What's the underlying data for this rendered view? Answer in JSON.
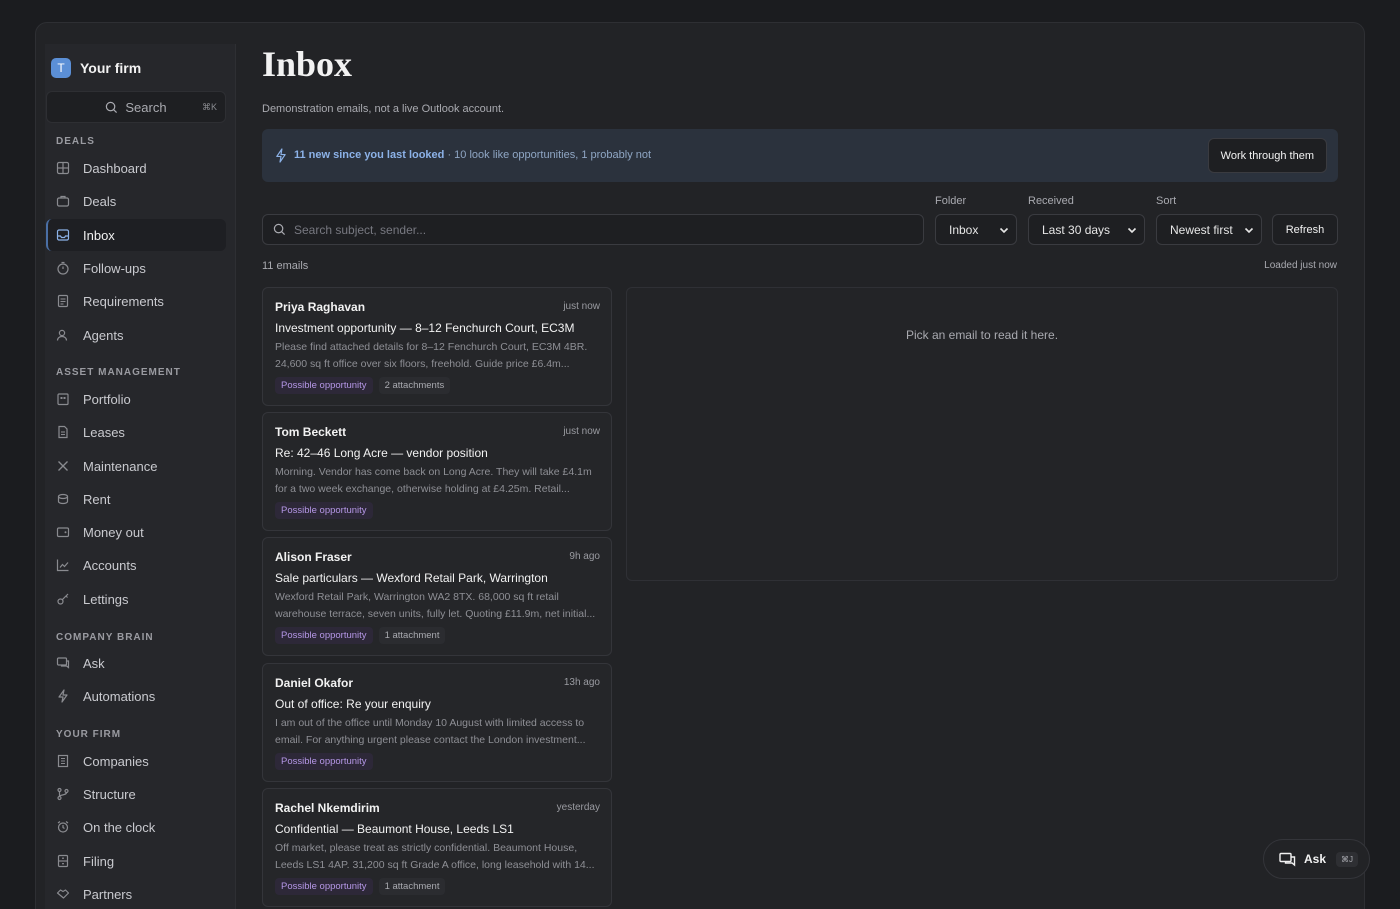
{
  "sidebar": {
    "brand_initial": "T",
    "brand_name": "Your firm",
    "search_label": "Search",
    "search_shortcut": "⌘K",
    "sections": [
      {
        "title": "DEALS"
      },
      {
        "title": "ASSET MANAGEMENT"
      },
      {
        "title": "COMPANY BRAIN"
      },
      {
        "title": "YOUR FIRM"
      }
    ],
    "items": [
      {
        "label": "Dashboard",
        "icon": "grid-icon"
      },
      {
        "label": "Deals",
        "icon": "briefcase-icon"
      },
      {
        "label": "Inbox",
        "icon": "inbox-icon"
      },
      {
        "label": "Follow-ups",
        "icon": "timer-icon"
      },
      {
        "label": "Requirements",
        "icon": "clipboard-icon"
      },
      {
        "label": "Agents",
        "icon": "users-icon"
      },
      {
        "label": "Portfolio",
        "icon": "building-icon"
      },
      {
        "label": "Leases",
        "icon": "document-icon"
      },
      {
        "label": "Maintenance",
        "icon": "wrench-icon"
      },
      {
        "label": "Rent",
        "icon": "coins-icon"
      },
      {
        "label": "Money out",
        "icon": "wallet-icon"
      },
      {
        "label": "Accounts",
        "icon": "chart-line-icon"
      },
      {
        "label": "Lettings",
        "icon": "key-icon"
      },
      {
        "label": "Ask",
        "icon": "chat-icon"
      },
      {
        "label": "Automations",
        "icon": "bolt-icon"
      },
      {
        "label": "Companies",
        "icon": "office-icon"
      },
      {
        "label": "Structure",
        "icon": "branch-icon"
      },
      {
        "label": "On the clock",
        "icon": "alarm-icon"
      },
      {
        "label": "Filing",
        "icon": "filing-icon"
      },
      {
        "label": "Partners",
        "icon": "handshake-icon"
      }
    ]
  },
  "main": {
    "title": "Inbox",
    "subtitle": "Demonstration emails, not a live Outlook account.",
    "banner": {
      "strong": "11 new since you last looked",
      "rest": " · 10 look like opportunities, 1 probably not",
      "button": "Work through them"
    },
    "filters": {
      "search_placeholder": "Search subject, sender...",
      "folder_label": "Folder",
      "folder_value": "Inbox",
      "received_label": "Received",
      "received_value": "Last 30 days",
      "sort_label": "Sort",
      "sort_value": "Newest first",
      "refresh": "Refresh"
    },
    "count": "11 emails",
    "loaded": "Loaded just now",
    "emails": [
      {
        "sender": "Priya Raghavan",
        "time": "just now",
        "subject": "Investment opportunity — 8–12 Fenchurch Court, EC3M",
        "preview": "Please find attached details for 8–12 Fenchurch Court, EC3M 4BR. 24,600 sq ft office over six floors, freehold. Guide price £6.4m...",
        "tag": "Possible opportunity",
        "attachments": "2 attachments"
      },
      {
        "sender": "Tom Beckett",
        "time": "just now",
        "subject": "Re: 42–46 Long Acre — vendor position",
        "preview": "Morning. Vendor has come back on Long Acre. They will take £4.1m for a two week exchange, otherwise holding at £4.25m. Retail...",
        "tag": "Possible opportunity",
        "attachments": ""
      },
      {
        "sender": "Alison Fraser",
        "time": "9h ago",
        "subject": "Sale particulars — Wexford Retail Park, Warrington",
        "preview": "Wexford Retail Park, Warrington WA2 8TX. 68,000 sq ft retail warehouse terrace, seven units, fully let. Quoting £11.9m, net initial...",
        "tag": "Possible opportunity",
        "attachments": "1 attachment"
      },
      {
        "sender": "Daniel Okafor",
        "time": "13h ago",
        "subject": "Out of office: Re your enquiry",
        "preview": "I am out of the office until Monday 10 August with limited access to email. For anything urgent please contact the London investment...",
        "tag": "Possible opportunity",
        "attachments": ""
      },
      {
        "sender": "Rachel Nkemdirim",
        "time": "yesterday",
        "subject": "Confidential — Beaumont House, Leeds LS1",
        "preview": "Off market, please treat as strictly confidential. Beaumont House, Leeds LS1 4AP. 31,200 sq ft Grade A office, long leasehold with 14...",
        "tag": "Possible opportunity",
        "attachments": "1 attachment"
      }
    ],
    "reader_placeholder": "Pick an email to read it here."
  },
  "ask": {
    "label": "Ask",
    "shortcut": "⌘J"
  },
  "colors": {
    "accent": "#5b8fd6",
    "tag_purple": "#b597e6",
    "banner_bg": "#2b323d"
  }
}
